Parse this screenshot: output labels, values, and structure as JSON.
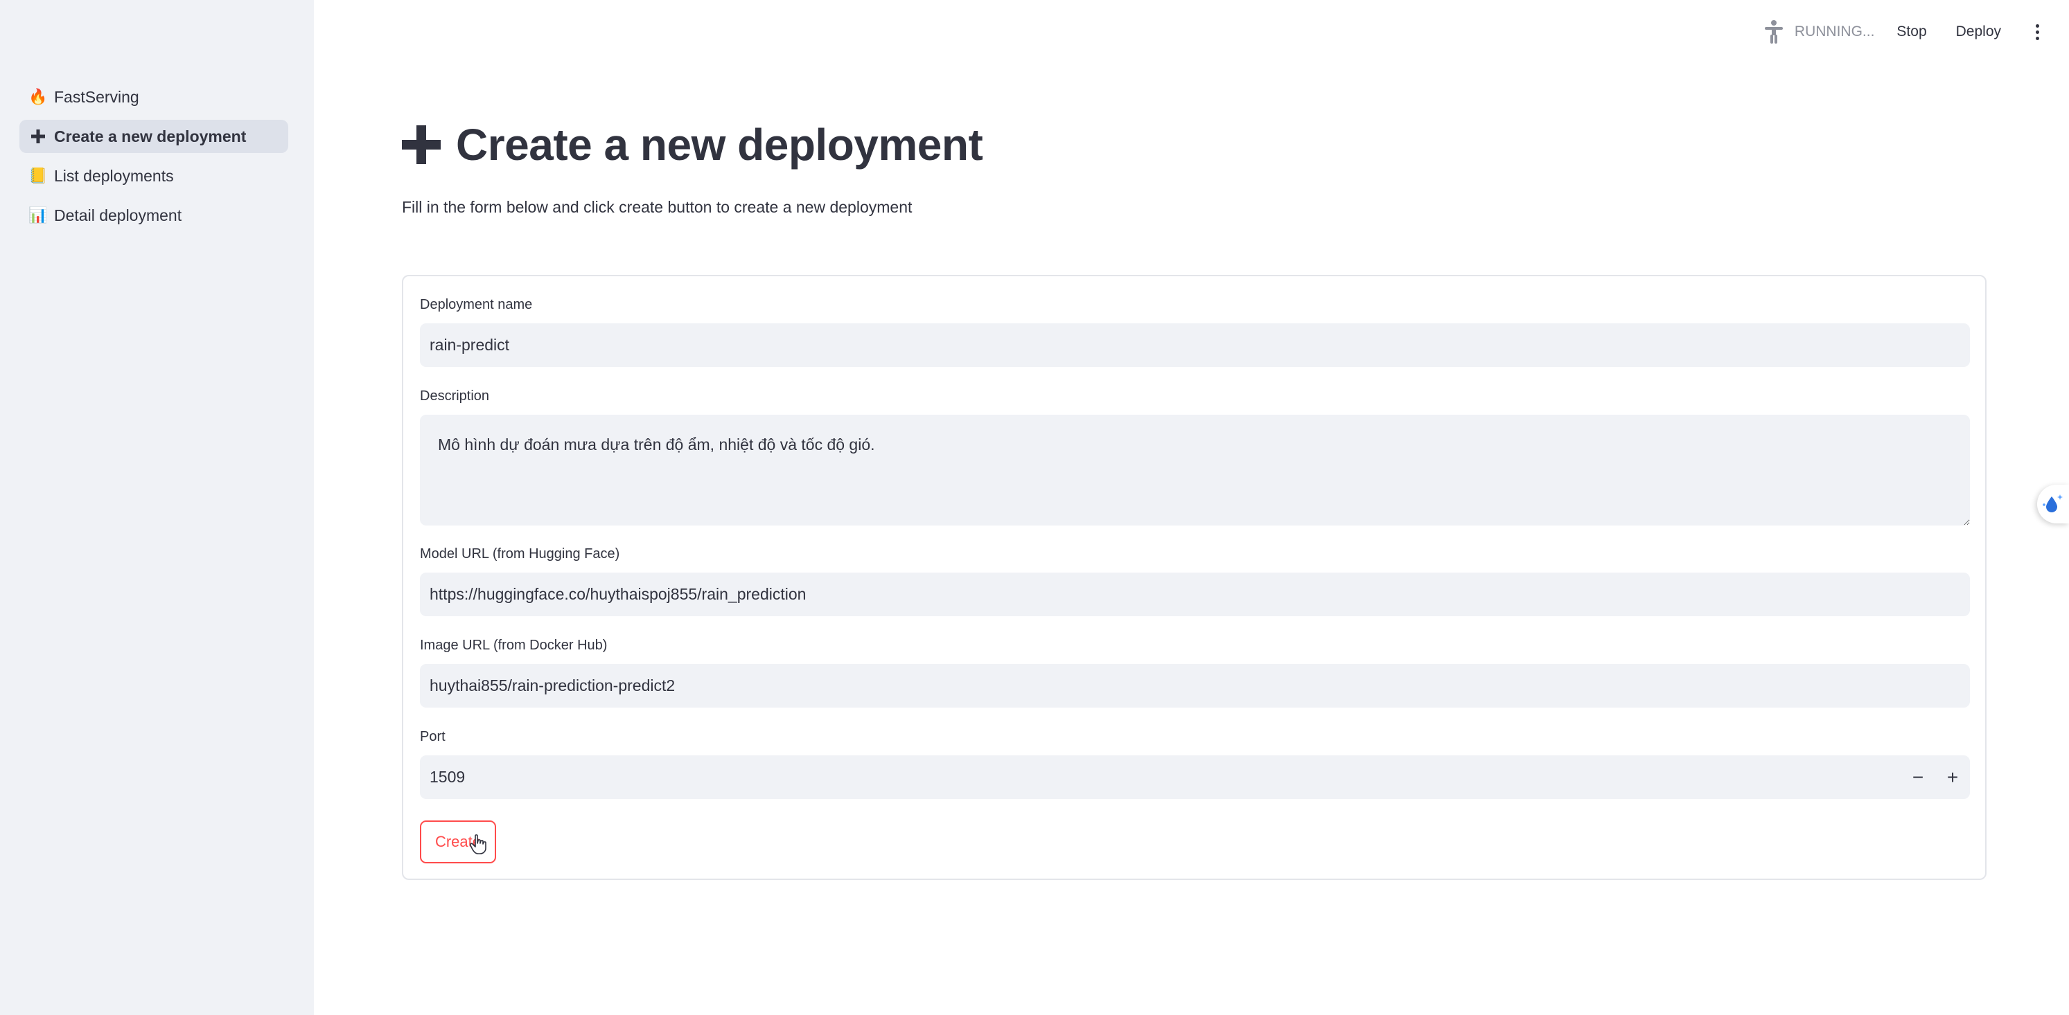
{
  "sidebar": {
    "items": [
      {
        "icon": "fire-icon",
        "glyph": "🔥",
        "label": "FastServing",
        "active": false
      },
      {
        "icon": "plus-icon",
        "glyph": "✚",
        "label": "Create a new deployment",
        "active": true
      },
      {
        "icon": "ledger-icon",
        "glyph": "📒",
        "label": "List deployments",
        "active": false
      },
      {
        "icon": "bar-chart-icon",
        "glyph": "📊",
        "label": "Detail deployment",
        "active": false
      }
    ]
  },
  "header": {
    "status_text": "RUNNING...",
    "stop_label": "Stop",
    "deploy_label": "Deploy"
  },
  "main": {
    "title": "Create a new deployment",
    "subtitle": "Fill in the form below and click create button to create a new deployment"
  },
  "form": {
    "deployment_name": {
      "label": "Deployment name",
      "value": "rain-predict"
    },
    "description": {
      "label": "Description",
      "value": "Mô hình dự đoán mưa dựa trên độ ẩm, nhiệt độ và tốc độ gió."
    },
    "model_url": {
      "label": "Model URL (from Hugging Face)",
      "value": "https://huggingface.co/huythaispoj855/rain_prediction"
    },
    "image_url": {
      "label": "Image URL (from Docker Hub)",
      "value": "huythai855/rain-prediction-predict2"
    },
    "port": {
      "label": "Port",
      "value": "1509",
      "decrement": "−",
      "increment": "+"
    },
    "create_label": "Create"
  },
  "colors": {
    "sidebar_bg": "#f0f2f6",
    "input_bg": "#f0f2f6",
    "accent": "#ff4b4b",
    "text": "#31333f",
    "muted": "#8e919b"
  }
}
